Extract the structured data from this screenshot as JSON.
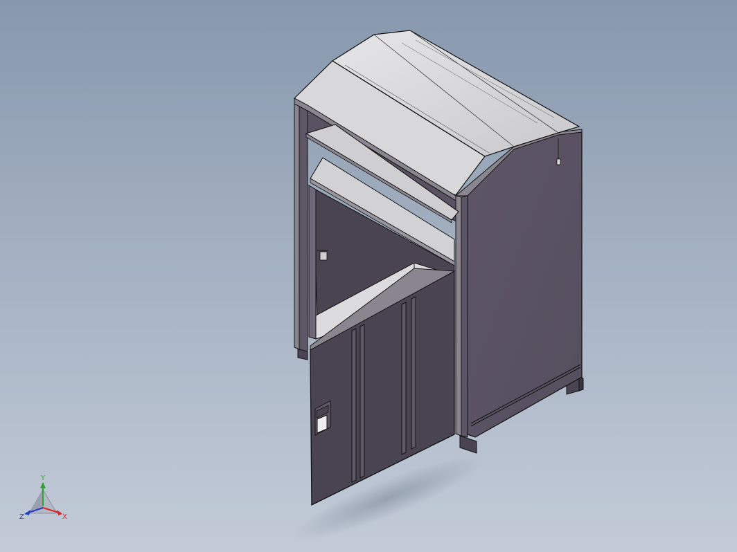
{
  "viewport": {
    "background_top": "#8798ad",
    "background_bottom": "#c3cbd8"
  },
  "model": {
    "name": "clothing-recycling-bin",
    "body_color": "#5a5262",
    "interior_color": "#d6d6d8",
    "edge_color": "#111111"
  },
  "triad": {
    "x_label": "X",
    "y_label": "Y",
    "z_label": "Z",
    "x_color": "#d8262c",
    "y_color": "#2ca52c",
    "z_color": "#2b3fc6"
  }
}
